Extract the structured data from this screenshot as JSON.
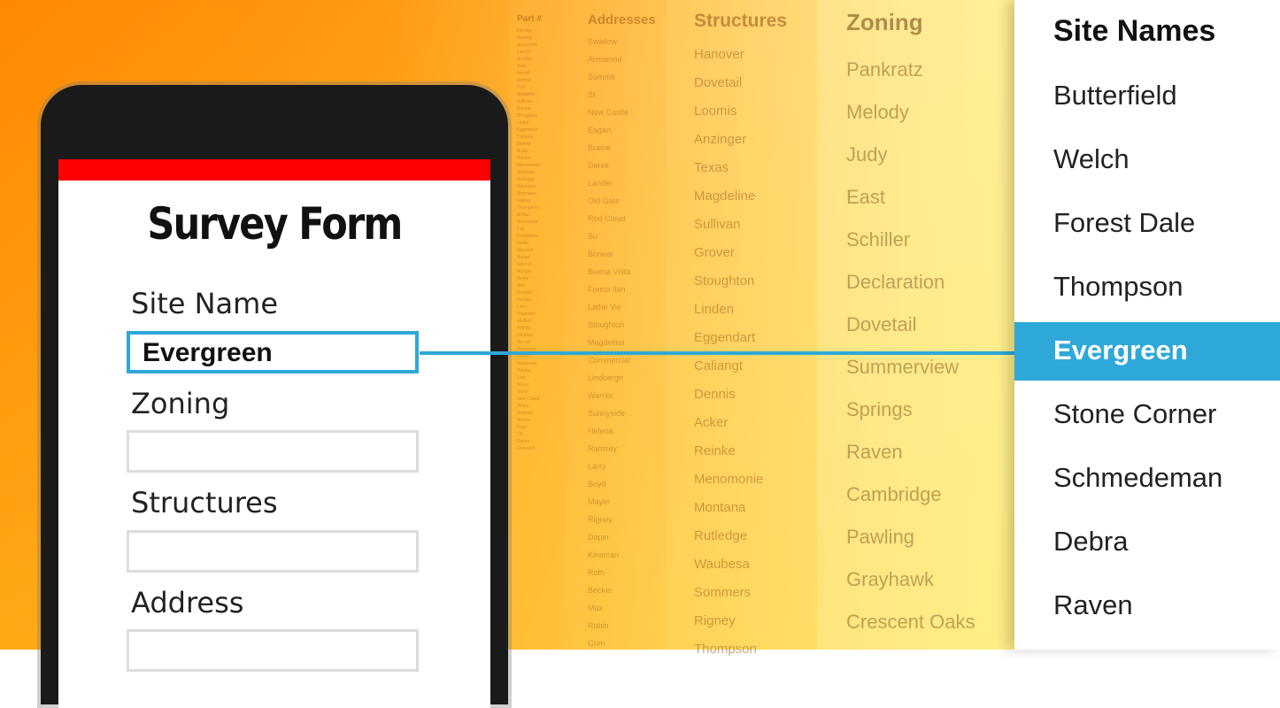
{
  "background_columns": {
    "part": {
      "header": "Part #",
      "items": [
        "Flexing",
        "Strathgr",
        "Sunnyside",
        "Lunchf",
        "Acushy",
        "Walk",
        "Berndt",
        "Acchan",
        "Pirkl",
        "Magdelin",
        "Sullivan",
        "Bonsai",
        "Stoughton",
        "Lindsr",
        "Eggendart",
        "Caliangt",
        "Dennis",
        "Acker",
        "Reinke",
        "Menomonie",
        "Montana",
        "Rutledge",
        "Waubesa",
        "Sommers",
        "Rigney",
        "Thompson",
        "Brittan",
        "Sunnyside",
        "Fall",
        "Fieldgrass",
        "Nettle",
        "Maxwell",
        "Brittan",
        "Keinnet",
        "Ansgar",
        "Ruthy",
        "Wnt",
        "Prosper",
        "Tordale",
        "Larry",
        "Ravenhill",
        "Steffen",
        "Wilhite",
        "Chutney",
        "Berndt",
        "Rosenhat",
        "Fiztner",
        "Grayhawk",
        "Reinke",
        "Lent",
        "Meyer",
        "Hicks",
        "New Castle",
        "Jenny",
        "Roberts",
        "Anleys",
        "Faye",
        "Ch",
        "Raven",
        "Crescent"
      ]
    },
    "addresses": {
      "header": "Addresses",
      "items": [
        "Swallow",
        "Arrowood",
        "Summit",
        "St",
        "New Castle",
        "Eagan",
        "Braine",
        "Derek",
        "Lander",
        "Old Gate",
        "Red Cloud",
        "Su",
        "Bonear",
        "Buena Vista",
        "Forest Ilan",
        "Lathe Vie",
        "Stoughton",
        "Magdelina",
        "Commercial",
        "Lindbergh",
        "Warrior",
        "Sunnyside",
        "Helena",
        "Ramsey",
        "Larry",
        "Boyd",
        "Mayer",
        "Rigney",
        "Dapin",
        "Kinsman",
        "Roth",
        "Becker",
        "Max",
        "Rubin",
        "Grim"
      ]
    },
    "structures": {
      "header": "Structures",
      "items": [
        "Hanover",
        "Dovetail",
        "Loomis",
        "Anzinger",
        "Texas",
        "Magdeline",
        "Sullivan",
        "Grover",
        "Stoughton",
        "Linden",
        "Eggendart",
        "Caliangt",
        "Dennis",
        "Acker",
        "Reinke",
        "Menomonie",
        "Montana",
        "Rutledge",
        "Waubesa",
        "Sommers",
        "Rigney",
        "Thompson"
      ]
    },
    "zoning": {
      "header": "Zoning",
      "items": [
        "Pankratz",
        "Melody",
        "Judy",
        "East",
        "Schiller",
        "Declaration",
        "Dovetail",
        "Summerview",
        "Springs",
        "Raven",
        "Cambridge",
        "Pawling",
        "Grayhawk",
        "Crescent Oaks"
      ]
    }
  },
  "form": {
    "title": "Survey Form",
    "site_name_label": "Site Name",
    "site_name_value": "Evergreen",
    "zoning_label": "Zoning",
    "structures_label": "Structures",
    "address_label": "Address"
  },
  "site_names": {
    "title": "Site Names",
    "items": [
      "Butterfield",
      "Welch",
      "Forest Dale",
      "Thompson",
      "Evergreen",
      "Stone Corner",
      "Schmedeman",
      "Debra",
      "Raven"
    ],
    "selected": "Evergreen"
  },
  "colors": {
    "accent": "#2ea8d8",
    "phone_header": "#ff0000",
    "bg_start": "#ff8800",
    "bg_end": "#fff08e"
  }
}
